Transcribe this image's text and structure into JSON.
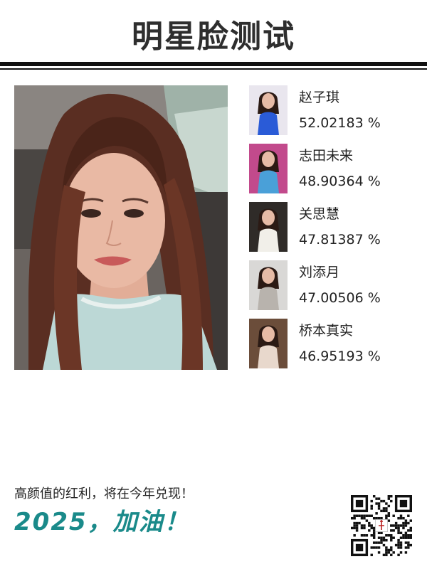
{
  "header": {
    "title": "明星脸测试"
  },
  "main_photo": {
    "icon": "selfie-photo",
    "colors": {
      "background": "#5b5552",
      "hair": "#5a2e22",
      "skin": "#e9b9a4",
      "shirt": "#bcd8d6"
    }
  },
  "results": [
    {
      "name": "赵子琪",
      "score": "52.02183 %",
      "thumb_color": "#2a5bd7",
      "thumb_bg": "#e9e6ee"
    },
    {
      "name": "志田未来",
      "score": "48.90364 %",
      "thumb_color": "#4aa0d8",
      "thumb_bg": "#c24a8c"
    },
    {
      "name": "关思慧",
      "score": "47.81387 %",
      "thumb_color": "#f1efe9",
      "thumb_bg": "#2f2b28"
    },
    {
      "name": "刘添月",
      "score": "47.00506 %",
      "thumb_color": "#b8b3ad",
      "thumb_bg": "#d9d8d6"
    },
    {
      "name": "桥本真实",
      "score": "46.95193 %",
      "thumb_color": "#e8d8cc",
      "thumb_bg": "#6b4d3a"
    }
  ],
  "footer": {
    "slogan": "高颜值的红利，将在今年兑现！",
    "cheer": "2025，加油！",
    "cheer_color": "#1a8a8a",
    "qr_icon": "qr-code"
  }
}
